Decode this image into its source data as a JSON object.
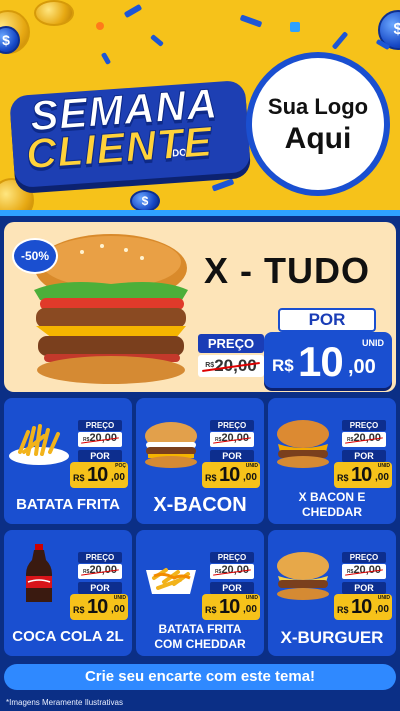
{
  "header": {
    "title_line1": "SEMANA",
    "title_connector": "DO",
    "title_line2": "CLIENTE",
    "logo_line1": "Sua Logo",
    "logo_line2": "Aqui"
  },
  "featured": {
    "discount": "-50%",
    "name": "X - TUDO",
    "preco_label": "PREÇO",
    "old_currency": "R$",
    "old_price": "20,00",
    "por_label": "POR",
    "currency": "R$",
    "price_int": "10",
    "price_dec": ",00",
    "unit": "UNID"
  },
  "products": [
    {
      "name": "BATATA FRITA",
      "preco_label": "PREÇO",
      "old_currency": "R$",
      "old_price": "20,00",
      "por_label": "POR",
      "currency": "R$",
      "price_int": "10",
      "price_dec": ",00",
      "unit": "POÇ"
    },
    {
      "name": "X-BACON",
      "preco_label": "PREÇO",
      "old_currency": "R$",
      "old_price": "20,00",
      "por_label": "POR",
      "currency": "R$",
      "price_int": "10",
      "price_dec": ",00",
      "unit": "UNID"
    },
    {
      "name": "X BACON E CHEDDAR",
      "preco_label": "PREÇO",
      "old_currency": "R$",
      "old_price": "20,00",
      "por_label": "POR",
      "currency": "R$",
      "price_int": "10",
      "price_dec": ",00",
      "unit": "UNID"
    },
    {
      "name": "COCA COLA 2L",
      "preco_label": "PREÇO",
      "old_currency": "R$",
      "old_price": "20,00",
      "por_label": "POR",
      "currency": "R$",
      "price_int": "10",
      "price_dec": ",00",
      "unit": "UNID"
    },
    {
      "name": "BATATA FRITA COM CHEDDAR",
      "preco_label": "PREÇO",
      "old_currency": "R$",
      "old_price": "20,00",
      "por_label": "POR",
      "currency": "R$",
      "price_int": "10",
      "price_dec": ",00",
      "unit": "UNID"
    },
    {
      "name": "X-BURGUER",
      "preco_label": "PREÇO",
      "old_currency": "R$",
      "old_price": "20,00",
      "por_label": "POR",
      "currency": "R$",
      "price_int": "10",
      "price_dec": ",00",
      "unit": "UNID"
    }
  ],
  "cta": "Crie seu encarte com este tema!",
  "disclaimer": "*Imagens Meramente Ilustrativas",
  "colors": {
    "yellow": "#f6c21a",
    "blue": "#1a4fd0",
    "navy": "#0b2f86",
    "cream": "#fde4b8",
    "cta": "#2f89ff"
  }
}
